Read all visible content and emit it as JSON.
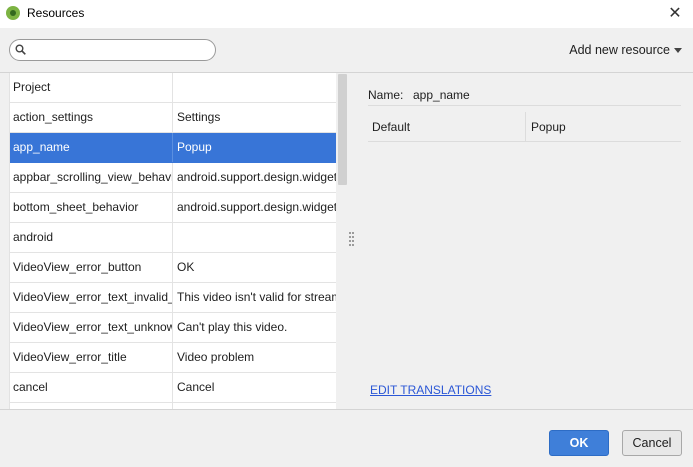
{
  "window": {
    "title": "Resources",
    "close_glyph": "✕",
    "icon": "android-studio-icon"
  },
  "toolbar": {
    "search": {
      "value": "",
      "placeholder": ""
    },
    "add_resource_label": "Add new resource"
  },
  "resources": {
    "rows": [
      {
        "key": "Project",
        "value": "",
        "type": "group"
      },
      {
        "key": "action_settings",
        "value": "Settings",
        "type": "item"
      },
      {
        "key": "app_name",
        "value": "Popup",
        "type": "item",
        "selected": true
      },
      {
        "key": "appbar_scrolling_view_behavior",
        "value": "android.support.design.widget.AppBarLayout$ScrollingViewBehavior",
        "type": "item"
      },
      {
        "key": "bottom_sheet_behavior",
        "value": "android.support.design.widget.BottomSheetBehavior",
        "type": "item"
      },
      {
        "key": "android",
        "value": "",
        "type": "group"
      },
      {
        "key": "VideoView_error_button",
        "value": "OK",
        "type": "item"
      },
      {
        "key": "VideoView_error_text_invalid_progressive_playback",
        "value": "This video isn't valid for streaming to this device.",
        "type": "item"
      },
      {
        "key": "VideoView_error_text_unknown",
        "value": "Can't play this video.",
        "type": "item"
      },
      {
        "key": "VideoView_error_title",
        "value": "Video problem",
        "type": "item"
      },
      {
        "key": "cancel",
        "value": "Cancel",
        "type": "item"
      },
      {
        "key": "",
        "value": "",
        "type": "item"
      }
    ]
  },
  "detail": {
    "name_label": "Name:",
    "name_value": "app_name",
    "columns": {
      "default": "Default",
      "value": "Popup"
    },
    "edit_translations": "EDIT TRANSLATIONS"
  },
  "footer": {
    "ok_label": "OK",
    "cancel_label": "Cancel"
  },
  "colors": {
    "selection": "#3875d7",
    "ok_button": "#3f7fd9",
    "link": "#2b57d6"
  }
}
